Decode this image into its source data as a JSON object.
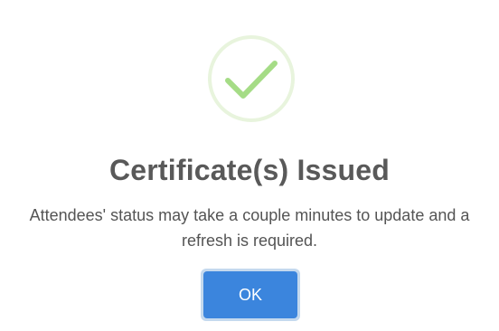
{
  "dialog": {
    "icon": "success-check-icon",
    "title": "Certificate(s) Issued",
    "message": "Attendees' status may take a couple minutes to update and a refresh is required.",
    "ok_label": "OK"
  },
  "colors": {
    "icon_ring": "#e8f4dd",
    "icon_check": "#a5dc86",
    "title_text": "#595959",
    "message_text": "#545454",
    "button_bg": "#3b85dd",
    "button_focus_ring": "#c4d9ee",
    "button_text": "#ffffff"
  }
}
